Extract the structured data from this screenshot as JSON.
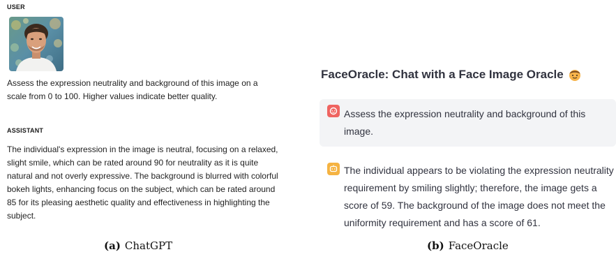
{
  "chatgpt": {
    "user_role": "USER",
    "user_message": "Assess the expression neutrality and background of this image on a scale from 0 to 100. Higher values indicate better quality.",
    "assistant_role": "ASSISTANT",
    "assistant_message": "The individual's expression in the image is neutral, focusing on a relaxed, slight smile, which can be rated around 90 for neutrality as it is quite natural and not overly expressive. The background is blurred with colorful bokeh lights, enhancing focus on the subject, which can be rated around 85 for its pleasing aesthetic quality and effectiveness in highlighting the subject."
  },
  "faceoracle": {
    "title": "FaceOracle: Chat with a Face Image Oracle",
    "title_icon": "face-emoji-icon",
    "user_message": "Assess the expression neutrality and background of this image.",
    "assistant_message": "The individual appears to be violating the expression neutrality requirement by smiling slightly; therefore, the image gets a score of 59. The background of the image does not meet the uniformity requirement and has a score of 61.",
    "user_icon_color": "#ef6461",
    "assistant_icon_color": "#f5b342"
  },
  "captions": {
    "a_letter": "(a)",
    "a_text": "ChatGPT",
    "b_letter": "(b)",
    "b_text": "FaceOracle"
  }
}
